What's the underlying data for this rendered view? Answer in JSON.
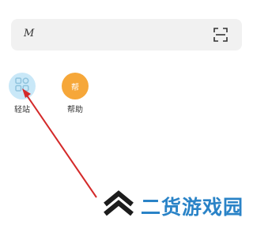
{
  "search": {
    "text": "M"
  },
  "icons": {
    "scan": "scan-icon",
    "qingzhan": "grid-apps-icon"
  },
  "shortcuts": [
    {
      "label": "轻站"
    },
    {
      "label": "帮助",
      "glyph": "帮"
    }
  ],
  "watermark": {
    "text": "二货游戏园"
  },
  "colors": {
    "search_bg": "#f1f1f1",
    "qingzhan_circle": "#c9e8f8",
    "qingzhan_icon": "#8fc3dd",
    "help_circle": "#f6a739",
    "arrow": "#d42a2a",
    "watermark_text": "#2a83c7",
    "watermark_logo": "#1c1c1c"
  }
}
